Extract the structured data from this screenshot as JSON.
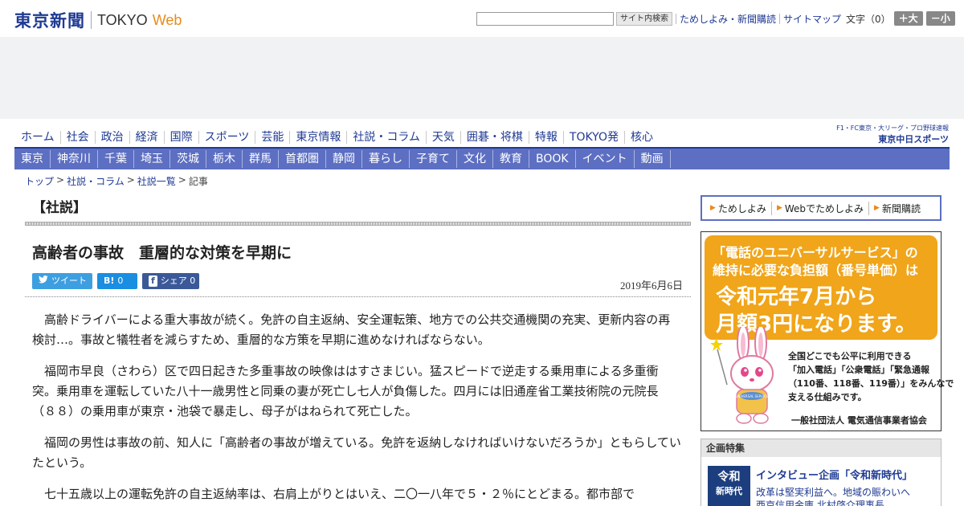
{
  "header": {
    "logo_jp": "東京新聞",
    "logo_en": "TOKYO",
    "logo_web": "Web",
    "search_button": "サイト内検索",
    "links": [
      "ためしよみ・新聞購読",
      "サイトマップ"
    ],
    "font_size_label": "文字（0）",
    "font_plus": "＋大",
    "font_minus": "－小"
  },
  "main_nav": [
    "ホーム",
    "社会",
    "政治",
    "経済",
    "国際",
    "スポーツ",
    "芸能",
    "東京情報",
    "社説・コラム",
    "天気",
    "囲碁・将棋",
    "特報",
    "TOKYO発",
    "核心"
  ],
  "sports_logo": {
    "small": "F1・FC東京・大リーグ・プロ野球速報",
    "big": "東京中日スポーツ"
  },
  "sub_nav": [
    "東京",
    "神奈川",
    "千葉",
    "埼玉",
    "茨城",
    "栃木",
    "群馬",
    "首都圏",
    "静岡",
    "暮らし",
    "子育て",
    "文化",
    "教育",
    "BOOK",
    "イベント",
    "動画"
  ],
  "breadcrumb": {
    "items": [
      "トップ",
      "社説・コラム",
      "社説一覧"
    ],
    "current": "記事",
    "sep": ">"
  },
  "article": {
    "section": "【社説】",
    "title": "高齢者の事故　重層的な対策を早期に",
    "date": "2019年6月6日",
    "share": {
      "tweet": "ツイート",
      "hatena_icon": "B!",
      "hatena_count": "0",
      "facebook_icon": "f",
      "facebook_label": "シェア 0"
    },
    "paragraphs": [
      "高齢ドライバーによる重大事故が続く。免許の自主返納、安全運転策、地方での公共交通機関の充実、更新内容の再検討…。事故と犠牲者を減らすため、重層的な方策を早期に進めなければならない。",
      "福岡市早良（さわら）区で四日起きた多重事故の映像ははすさまじい。猛スピードで逆走する乗用車による多重衝突。乗用車を運転していた八十一歳男性と同乗の妻が死亡し七人が負傷した。四月には旧通産省工業技術院の元院長（８８）の乗用車が東京・池袋で暴走し、母子がはねられて死亡した。",
      "福岡の男性は事故の前、知人に「高齢者の事故が増えている。免許を返納しなければいけないだろうか」ともらしていたという。",
      "七十五歳以上の運転免許の自主返納率は、右肩上がりとはいえ、二〇一八年で５・２％にとどまる。都市部で"
    ]
  },
  "subscribe": {
    "links": [
      "ためしよみ",
      "Webでためしよみ",
      "新聞購読"
    ]
  },
  "ad_banner": {
    "line1": "「電話のユニバーサルサービス」の",
    "line2": "維持に必要な負担額（番号単価）は",
    "big1": "令和元年7月から",
    "big2": "月額3円になります。",
    "text": [
      "全国どこでも公平に利用できる",
      "「加入電話」「公衆電話」「緊急通報",
      "（110番、118番、119番）」をみんなで",
      "支える仕組みです。"
    ],
    "org": "一般社団法人 電気通信事業者協会",
    "badge": "UNIVERSAL SERVICE"
  },
  "kikaku": {
    "heading": "企画特集",
    "img_top": "令和",
    "img_bottom": "新時代",
    "title": "インタビュー企画「令和新時代」",
    "text": [
      "改革は堅実利益へ。地域の賑わいへ",
      "西京信用金庫 北村啓介理事長"
    ]
  },
  "colors": {
    "brand_blue": "#1f3a93",
    "subnav_bg": "#5d6fc2",
    "accent_orange": "#e98a1c",
    "ad_orange": "#f0a51a"
  }
}
